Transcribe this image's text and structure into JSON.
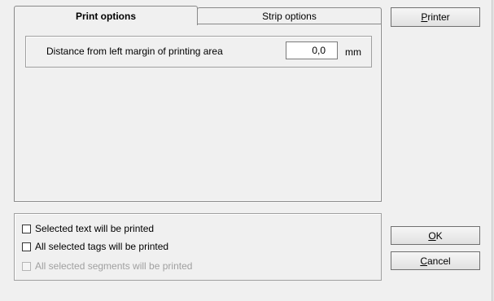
{
  "tabs": [
    {
      "label": "Print options",
      "active": true
    },
    {
      "label": "Strip options",
      "active": false
    }
  ],
  "print_options": {
    "distance_label": "Distance from left margin of printing area",
    "distance_value": "0,0",
    "unit": "mm"
  },
  "options": [
    {
      "label": "Selected text will be printed",
      "checked": false,
      "enabled": true
    },
    {
      "label": "All selected tags will be printed",
      "checked": false,
      "enabled": true
    },
    {
      "label": "All selected segments will be printed",
      "checked": false,
      "enabled": false
    }
  ],
  "buttons": {
    "printer": {
      "mnemonic": "P",
      "rest": "rinter"
    },
    "ok": {
      "mnemonic": "O",
      "rest": "K"
    },
    "cancel": {
      "mnemonic": "C",
      "rest": "ancel"
    }
  }
}
